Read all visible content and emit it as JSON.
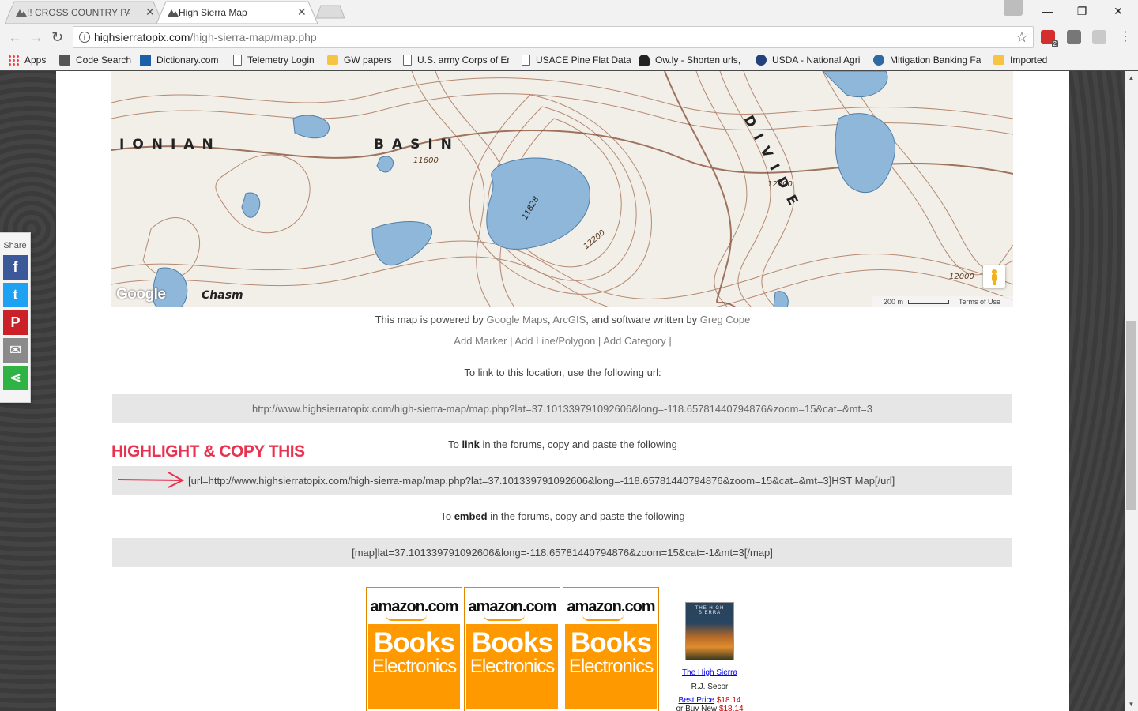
{
  "browser": {
    "tabs": [
      {
        "title": "!! CROSS COUNTRY PASS",
        "active": false
      },
      {
        "title": "High Sierra Map",
        "active": true
      }
    ],
    "url": {
      "host": "highsierratopix.com",
      "path": "/high-sierra-map/map.php"
    },
    "extension_badge": "2",
    "bookmarks": [
      {
        "label": "Apps",
        "icon": "apps-grid-icon"
      },
      {
        "label": "Code Search",
        "icon": "code-search-icon"
      },
      {
        "label": "Dictionary.com",
        "icon": "dictionary-icon"
      },
      {
        "label": "Telemetry Login",
        "icon": "page-icon"
      },
      {
        "label": "GW papers",
        "icon": "folder-icon"
      },
      {
        "label": "U.S. army Corps of En",
        "icon": "page-icon"
      },
      {
        "label": "USACE Pine Flat Data",
        "icon": "page-icon"
      },
      {
        "label": "Ow.ly - Shorten urls, s",
        "icon": "owly-icon"
      },
      {
        "label": "USDA - National Agri",
        "icon": "usda-icon"
      },
      {
        "label": "Mitigation Banking Fa",
        "icon": "mitigation-icon"
      },
      {
        "label": "Imported",
        "icon": "folder-icon"
      }
    ]
  },
  "map": {
    "labels": {
      "basin_left": "IONIAN",
      "basin_right": "BASIN",
      "divide": "DIVIDE",
      "chasm": "Chasm"
    },
    "elevations": [
      "11600",
      "11828",
      "12200",
      "12800",
      "12000"
    ],
    "google_logo": "Google",
    "scale": "200 m",
    "terms": "Terms of Use"
  },
  "powered": {
    "prefix": "This map is powered by ",
    "google_maps": "Google Maps",
    "sep1": ", ",
    "arcgis": "ArcGIS",
    "middle": ", and software written by ",
    "author": "Greg Cope"
  },
  "actions": {
    "add_marker": "Add Marker",
    "add_line": "Add Line/Polygon",
    "add_category": "Add Category",
    "sep": " | "
  },
  "link_section": {
    "intro": "To link to this location, use the following url:",
    "url": "http://www.highsierratopix.com/high-sierra-map/map.php?lat=37.101339791092606&long=-118.65781440794876&zoom=15&cat=&mt=3"
  },
  "forum_link_section": {
    "intro_before": "To ",
    "intro_bold": "link",
    "intro_after": " in the forums, copy and paste the following",
    "code": "[url=http://www.highsierratopix.com/high-sierra-map/map.php?lat=37.101339791092606&long=-118.65781440794876&zoom=15&cat=&mt=3]HST Map[/url]",
    "annotation": "HIGHLIGHT & COPY THIS"
  },
  "embed_section": {
    "intro_before": "To ",
    "intro_bold": "embed",
    "intro_after": " in the forums, copy and paste the following",
    "code": "[map]lat=37.101339791092606&long=-118.65781440794876&zoom=15&cat=-1&mt=3[/map]"
  },
  "ads": [
    {
      "brand": "amazon.com",
      "line1": "Books",
      "line2": "Electronics"
    },
    {
      "brand": "amazon.com",
      "line1": "Books",
      "line2": "Electronics"
    },
    {
      "brand": "amazon.com",
      "line1": "Books",
      "line2": "Electronics"
    }
  ],
  "book": {
    "cover_title": "THE HIGH SIERRA",
    "title": "The High Sierra",
    "author": "R.J. Secor",
    "best_price_label": "Best Price",
    "best_price": "$18.14",
    "buy_new_label": "or Buy New",
    "buy_new_price": "$18.14"
  },
  "share": {
    "label": "Share",
    "buttons": [
      {
        "name": "facebook",
        "glyph": "f",
        "color": "#3b5998"
      },
      {
        "name": "twitter",
        "glyph": "t",
        "color": "#1da1f2"
      },
      {
        "name": "pinterest",
        "glyph": "P",
        "color": "#cb2027"
      },
      {
        "name": "email",
        "glyph": "✉",
        "color": "#8a8a8a"
      },
      {
        "name": "more",
        "glyph": "⋖",
        "color": "#2fb344"
      }
    ]
  }
}
